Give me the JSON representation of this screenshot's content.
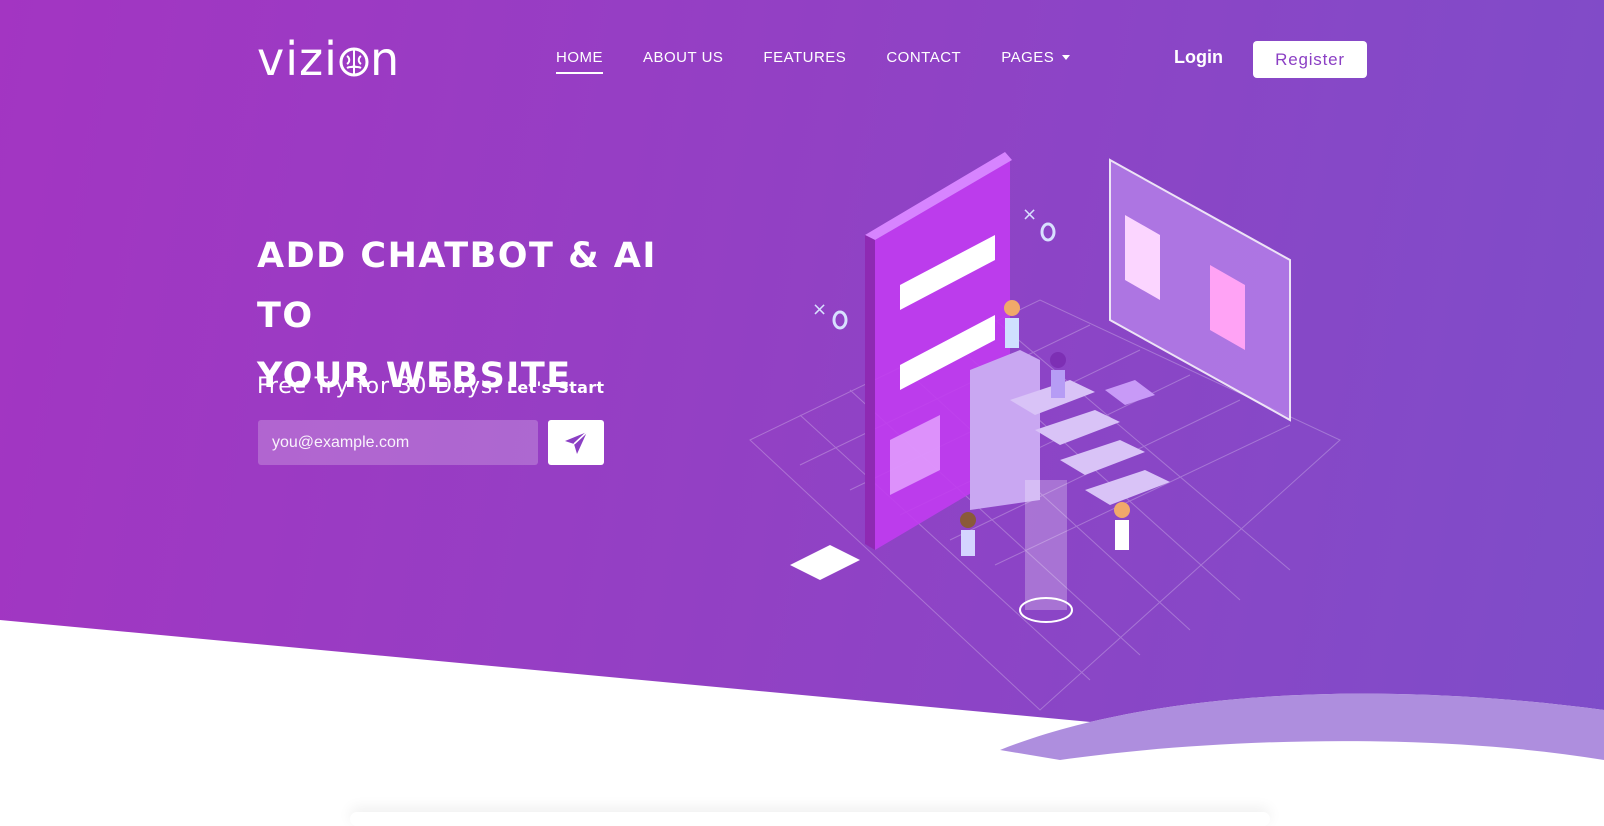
{
  "header": {
    "logo_text_left": "vizi",
    "logo_text_right": "n",
    "nav": [
      {
        "label": "HOME",
        "active": true
      },
      {
        "label": "ABOUT US",
        "active": false
      },
      {
        "label": "FEATURES",
        "active": false
      },
      {
        "label": "CONTACT",
        "active": false
      },
      {
        "label": "PAGES",
        "active": false,
        "dropdown": true
      }
    ],
    "login_label": "Login",
    "register_label": "Register"
  },
  "hero": {
    "headline_line1": "ADD CHATBOT & AI TO",
    "headline_line2": "YOUR WEBSITE",
    "subline": "Free Try for 30 Days.",
    "cta_text": "Let's Start",
    "email_placeholder": "you@example.com",
    "send_icon": "paper-plane-icon"
  },
  "colors": {
    "gradient_start": "#a335c2",
    "gradient_end": "#7e4dc9",
    "accent": "#8b3fc4",
    "white": "#ffffff"
  }
}
